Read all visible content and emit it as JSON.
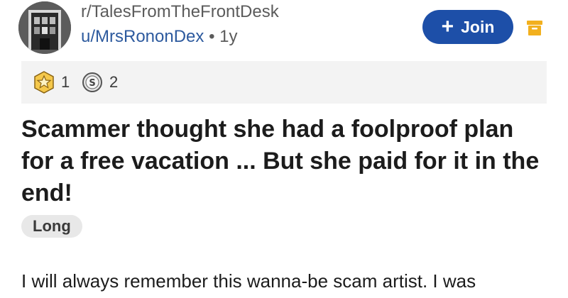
{
  "header": {
    "subreddit": "r/TalesFromTheFrontDesk",
    "author": "u/MrsRononDex",
    "separator": "•",
    "age": "1y",
    "join_label": "Join",
    "join_icon": "plus-icon",
    "archive_icon": "archive-icon",
    "accent_color": "#1d4fa8"
  },
  "awards": [
    {
      "icon": "star-award-icon",
      "count": "1"
    },
    {
      "icon": "silver-award-icon",
      "count": "2"
    }
  ],
  "post": {
    "title": "Scammer thought she had a foolproof plan for a free vacation ... But she paid for it in the end!",
    "flair": "Long",
    "body_preview": "I will always remember this wanna-be scam artist.  I was"
  }
}
